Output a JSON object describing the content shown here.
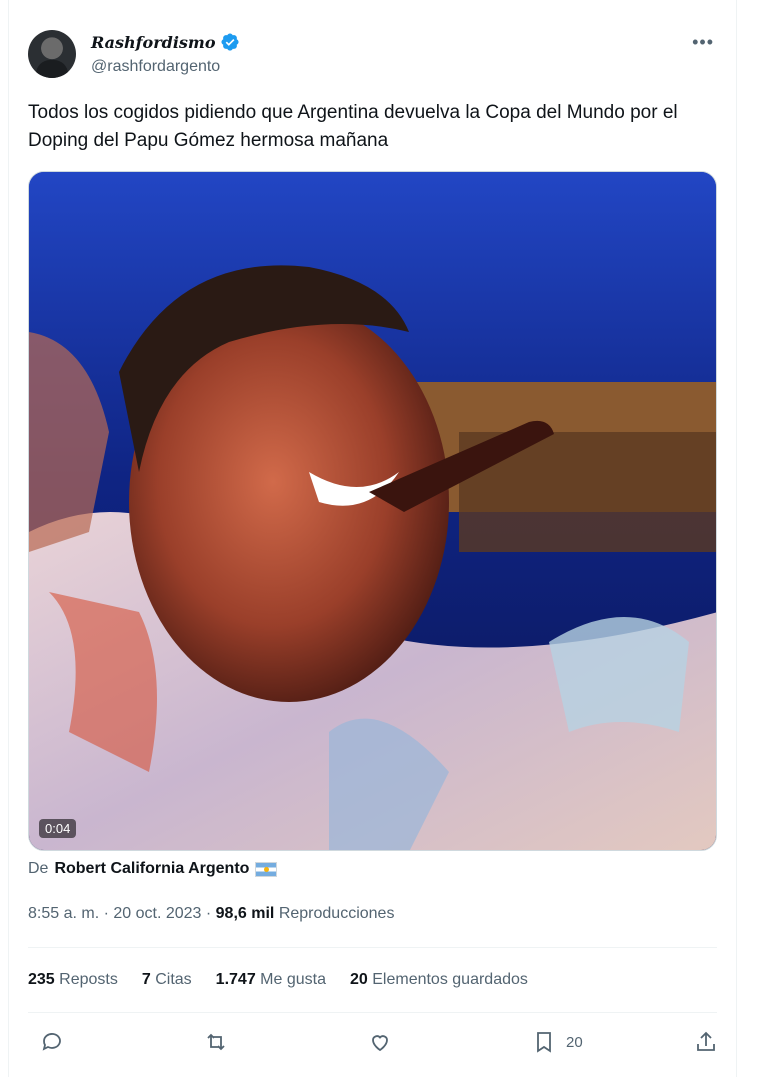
{
  "author": {
    "display_name": "Rashfordismo",
    "handle": "@rashfordargento",
    "verified": true
  },
  "tweet": {
    "text": "Todos los cogidos pidiendo que Argentina devuelva la Copa del Mundo por el Doping del Papu Gómez hermosa mañana"
  },
  "media": {
    "duration": "0:04"
  },
  "source": {
    "prefix": "De",
    "name": "Robert California Argento"
  },
  "meta": {
    "time_date": "8:55 a. m. · 20 oct. 2023 · ",
    "views": "98,6 mil",
    "views_label": "Reproducciones"
  },
  "stats": {
    "reposts": "235",
    "reposts_label": "Reposts",
    "quotes": "7",
    "quotes_label": "Citas",
    "likes": "1.747",
    "likes_label": "Me gusta",
    "bookmarks": "20",
    "bookmarks_label": "Elementos guardados"
  },
  "actions": {
    "bookmark_count": "20"
  },
  "colors": {
    "verified": "#1d9bf0",
    "secondary_text": "#536471",
    "primary_text": "#0f1419"
  }
}
